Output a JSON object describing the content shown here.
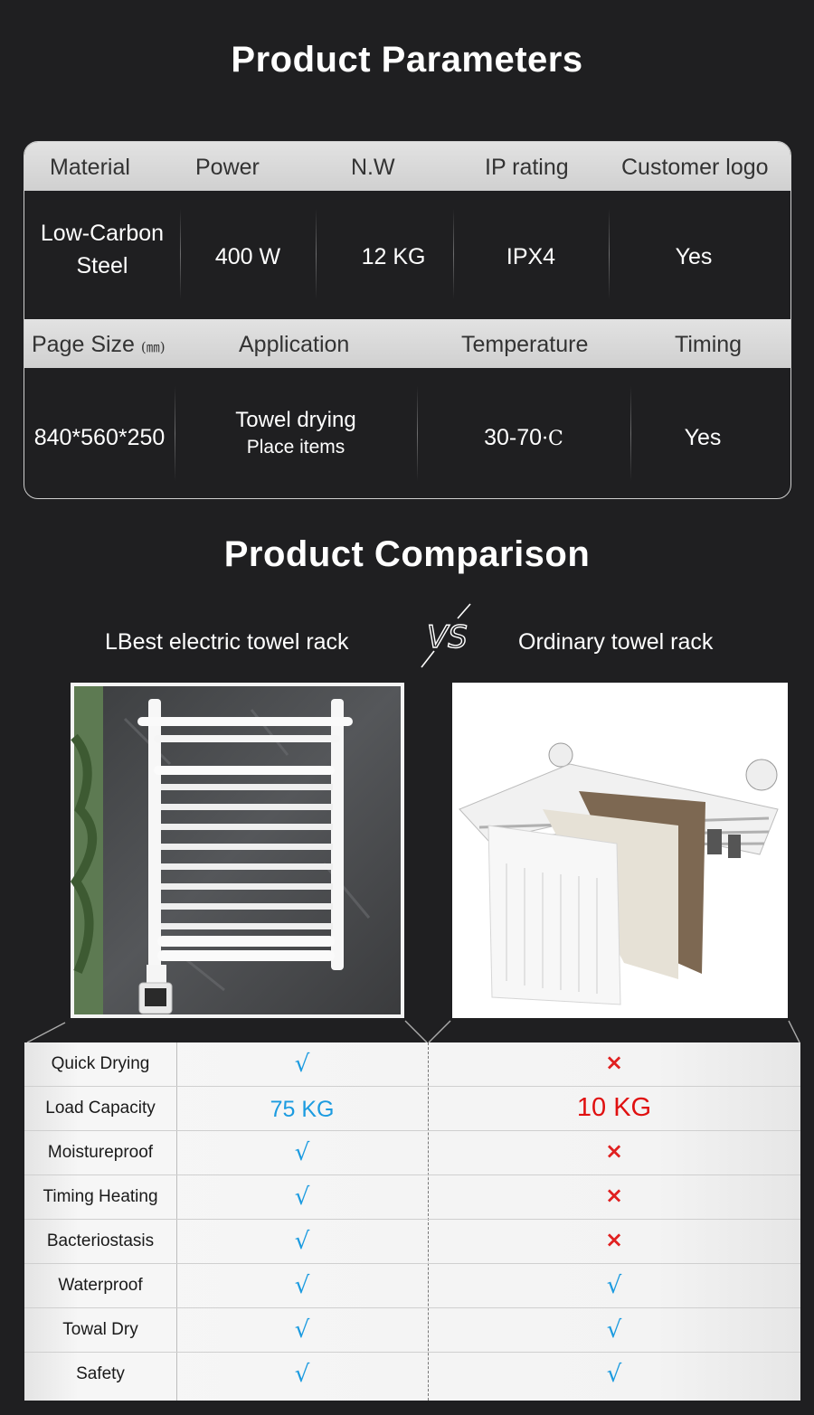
{
  "params": {
    "title": "Product Parameters",
    "header1": [
      "Material",
      "Power",
      "N.W",
      "IP rating",
      "Customer logo"
    ],
    "row1": {
      "material_line1": "Low-Carbon",
      "material_line2": "Steel",
      "power": "400 W",
      "nw": "12 KG",
      "ip": "IPX4",
      "logo": "Yes"
    },
    "header2": {
      "page_size": "Page Size",
      "page_size_unit": "(㎜)",
      "application": "Application",
      "temperature": "Temperature",
      "timing": "Timing"
    },
    "row2": {
      "size": "840*560*250",
      "application_line1": "Towel drying",
      "application_line2": "Place items",
      "temperature": "30-70",
      "temperature_unit": "·C",
      "timing": "Yes"
    }
  },
  "comparison": {
    "title": "Product Comparison",
    "left_label": "LBest electric towel rack",
    "vs": "VS",
    "right_label": "Ordinary towel rack",
    "rows": [
      {
        "feature": "Quick Drying",
        "a": "√",
        "b": "×"
      },
      {
        "feature": "Load Capacity",
        "a": "75 KG",
        "b": "10 KG"
      },
      {
        "feature": "Moistureproof",
        "a": "√",
        "b": "×"
      },
      {
        "feature": "Timing Heating",
        "a": "√",
        "b": "×"
      },
      {
        "feature": "Bacteriostasis",
        "a": "√",
        "b": "×"
      },
      {
        "feature": "Waterproof",
        "a": "√",
        "b": "√"
      },
      {
        "feature": "Towal Dry",
        "a": "√",
        "b": "√"
      },
      {
        "feature": "Safety",
        "a": "√",
        "b": "√"
      }
    ]
  },
  "colors": {
    "background": "#1f1f21",
    "check": "#1b9be0",
    "cross": "#e02020",
    "header_bg": "#d8d8d8"
  }
}
